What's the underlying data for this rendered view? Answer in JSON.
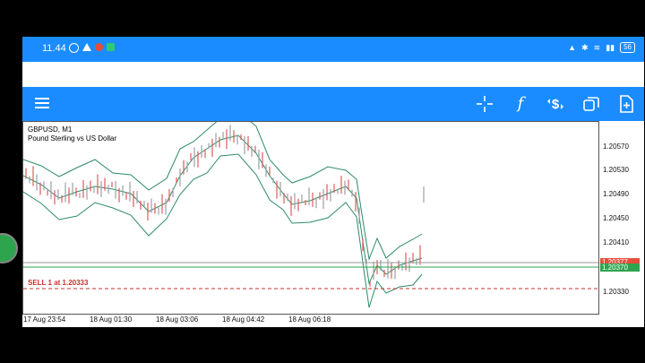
{
  "status": {
    "time": "11.44",
    "battery": "56"
  },
  "toolbar": {
    "menu_icon": "hamburger-icon",
    "buttons": [
      {
        "name": "crosshair",
        "icon": "crosshair-icon"
      },
      {
        "name": "indicators",
        "icon": "function-icon",
        "glyph": "f"
      },
      {
        "name": "new-order",
        "icon": "dollar-arrows-icon"
      },
      {
        "name": "chart-windows",
        "icon": "windows-icon"
      },
      {
        "name": "add-chart",
        "icon": "add-file-icon"
      }
    ]
  },
  "chart": {
    "symbol": "GBPUSD, M1",
    "description": "Pound Sterling vs US Dollar",
    "sell_label": "SELL 1 at 1.20333",
    "price_ticks": [
      "1.20570",
      "1.20530",
      "1.20490",
      "1.20450",
      "1.20410",
      "1.20330"
    ],
    "bid_tag": "1.20377",
    "ask_tag": "1.20370",
    "time_ticks": [
      "17 Aug 23:54",
      "18 Aug 01:30",
      "18 Aug 03:06",
      "18 Aug 04:42",
      "18 Aug 06:18"
    ],
    "colors": {
      "band": "#2e8b66",
      "bull": "#9aa0a6",
      "bear": "#e05a5a",
      "sell_line": "#c9302c",
      "ask": "#2ea44f",
      "bid": "#e74c3c"
    }
  }
}
